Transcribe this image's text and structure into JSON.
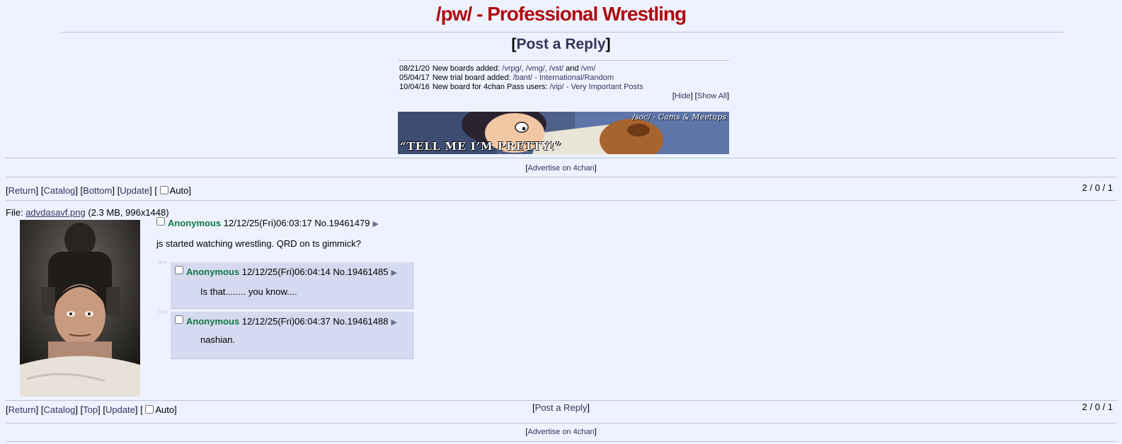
{
  "board": {
    "title": "/pw/ - Professional Wrestling"
  },
  "post_reply": {
    "label": "Post a Reply",
    "bracket_open": "[",
    "bracket_close": "]"
  },
  "news": [
    {
      "date": "08/21/20",
      "text": "New boards added:",
      "links": "/vrpg/, /vmg/, /vst/",
      "and": "and",
      "extra": "/vm/"
    },
    {
      "date": "05/04/17",
      "text": "New trial board added:",
      "links": "/bant/ - International/Random"
    },
    {
      "date": "10/04/16",
      "text": "New board for 4chan Pass users:",
      "links": "/vip/ - Very Important Posts"
    }
  ],
  "news_controls": {
    "hide": "Hide",
    "show_all": "Show All"
  },
  "banner": {
    "tag": "/soc/ - Cams & Meetups",
    "caption": "“TELL ME I’M PRETTY!”"
  },
  "advertise": {
    "label": "Advertise on 4chan"
  },
  "nav_top": {
    "return": "Return",
    "catalog": "Catalog",
    "bottom": "Bottom",
    "update": "Update",
    "auto": "Auto"
  },
  "nav_bottom": {
    "return": "Return",
    "catalog": "Catalog",
    "top": "Top",
    "update": "Update",
    "auto": "Auto"
  },
  "stats": {
    "text": "2 / 0 / 1"
  },
  "op": {
    "file_label": "File:",
    "file_name": "advdasavf.png",
    "file_meta": "(2.3 MB, 996x1448)",
    "name": "Anonymous",
    "datetime": "12/12/25(Fri)06:03:17",
    "no": "No.19461479",
    "message": "js started watching wrestling. QRD on ts gimmick?"
  },
  "replies": [
    {
      "name": "Anonymous",
      "datetime": "12/12/25(Fri)06:04:14",
      "no": "No.19461485",
      "message": "Is that........ you know...."
    },
    {
      "name": "Anonymous",
      "datetime": "12/12/25(Fri)06:04:37",
      "no": "No.19461488",
      "message": "nashian."
    }
  ],
  "side_arrows": ">>",
  "post_arrow": "▶",
  "colors": {
    "title": "#af0a0f",
    "name": "#117743",
    "bg": "#eef2ff",
    "reply_bg": "#d6daf0",
    "link": "#34345c"
  }
}
